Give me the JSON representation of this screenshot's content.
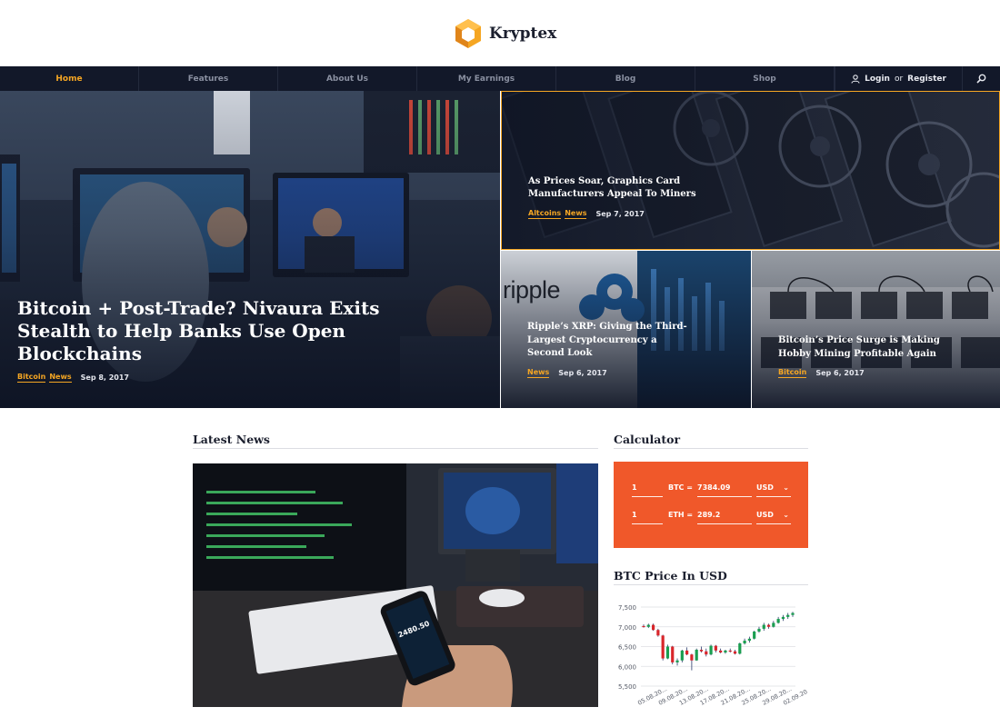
{
  "brand": {
    "name": "Kryptex",
    "accent": "#f5a623",
    "logo_icon": "hexagon-cube-icon"
  },
  "nav": {
    "items": [
      {
        "label": "Home",
        "active": true
      },
      {
        "label": "Features",
        "active": false
      },
      {
        "label": "About Us",
        "active": false
      },
      {
        "label": "My Earnings",
        "active": false
      },
      {
        "label": "Blog",
        "active": false
      },
      {
        "label": "Shop",
        "active": false
      }
    ],
    "login": {
      "label": "Login",
      "or": "or",
      "register": "Register",
      "icon": "user-icon"
    },
    "search_icon": "search-icon"
  },
  "hero": {
    "main": {
      "title_lines": [
        "Bitcoin + Post-Trade? Nivaura Exits",
        "Stealth to Help Banks Use Open",
        "Blockchains"
      ],
      "tags": [
        "Bitcoin",
        "News"
      ],
      "date": "Sep 8, 2017"
    },
    "top_right": {
      "title_lines": [
        "As Prices Soar, Graphics Card",
        "Manufacturers Appeal To Miners"
      ],
      "tags": [
        "Altcoins",
        "News"
      ],
      "date": "Sep 7, 2017"
    },
    "bottom_left": {
      "title_lines": [
        "Ripple’s XRP: Giving the Third-",
        "Largest Cryptocurrency a",
        "Second Look"
      ],
      "tags": [
        "News"
      ],
      "date": "Sep 6, 2017",
      "logo_text": "ripple"
    },
    "bottom_right": {
      "title_lines": [
        "Bitcoin’s Price Surge is Making",
        "Hobby Mining Profitable Again"
      ],
      "tags": [
        "Bitcoin"
      ],
      "date": "Sep 6, 2017"
    }
  },
  "latest_news": {
    "heading": "Latest News",
    "phone_price": "2480.50"
  },
  "calculator": {
    "heading": "Calculator",
    "color": "#f0582a",
    "rows": [
      {
        "amount": "1",
        "coin": "BTC =",
        "value": "7384.09",
        "currency": "USD"
      },
      {
        "amount": "1",
        "coin": "ETH =",
        "value": "289.2",
        "currency": "USD"
      }
    ]
  },
  "price_chart_heading": "BTC Price In USD",
  "chart_data": {
    "type": "candlestick",
    "title": "BTC Price In USD",
    "ylim": [
      5750,
      7600
    ],
    "y_ticks": [
      "7,500",
      "7,000",
      "6,500",
      "6,000",
      "5,500"
    ],
    "x_tick_labels": [
      "05.08.20...",
      "09.08.20...",
      "13.08.20...",
      "17.08.20...",
      "21.08.20...",
      "25.08.20...",
      "29.08.20...",
      "02.09.20..."
    ],
    "up_color": "#1a9e50",
    "down_color": "#d9262b",
    "grid": true,
    "candles": [
      {
        "o": 7020,
        "h": 7060,
        "l": 6980,
        "c": 7000
      },
      {
        "o": 7000,
        "h": 7080,
        "l": 6970,
        "c": 7050
      },
      {
        "o": 7050,
        "h": 7080,
        "l": 6900,
        "c": 6920
      },
      {
        "o": 6920,
        "h": 6950,
        "l": 6750,
        "c": 6780
      },
      {
        "o": 6780,
        "h": 6800,
        "l": 6150,
        "c": 6200
      },
      {
        "o": 6200,
        "h": 6550,
        "l": 6180,
        "c": 6500
      },
      {
        "o": 6500,
        "h": 6520,
        "l": 6050,
        "c": 6100
      },
      {
        "o": 6100,
        "h": 6200,
        "l": 6020,
        "c": 6150
      },
      {
        "o": 6150,
        "h": 6420,
        "l": 6100,
        "c": 6400
      },
      {
        "o": 6400,
        "h": 6480,
        "l": 6280,
        "c": 6300
      },
      {
        "o": 6300,
        "h": 6320,
        "l": 5900,
        "c": 6150
      },
      {
        "o": 6150,
        "h": 6450,
        "l": 6140,
        "c": 6420
      },
      {
        "o": 6420,
        "h": 6500,
        "l": 6350,
        "c": 6380
      },
      {
        "o": 6380,
        "h": 6450,
        "l": 6250,
        "c": 6300
      },
      {
        "o": 6300,
        "h": 6550,
        "l": 6280,
        "c": 6520
      },
      {
        "o": 6520,
        "h": 6540,
        "l": 6350,
        "c": 6400
      },
      {
        "o": 6400,
        "h": 6450,
        "l": 6330,
        "c": 6350
      },
      {
        "o": 6350,
        "h": 6420,
        "l": 6320,
        "c": 6400
      },
      {
        "o": 6400,
        "h": 6450,
        "l": 6350,
        "c": 6380
      },
      {
        "o": 6380,
        "h": 6420,
        "l": 6300,
        "c": 6320
      },
      {
        "o": 6320,
        "h": 6600,
        "l": 6300,
        "c": 6580
      },
      {
        "o": 6580,
        "h": 6700,
        "l": 6550,
        "c": 6650
      },
      {
        "o": 6650,
        "h": 6750,
        "l": 6600,
        "c": 6700
      },
      {
        "o": 6700,
        "h": 6900,
        "l": 6680,
        "c": 6880
      },
      {
        "o": 6880,
        "h": 7000,
        "l": 6850,
        "c": 6950
      },
      {
        "o": 6950,
        "h": 7100,
        "l": 6900,
        "c": 7050
      },
      {
        "o": 7050,
        "h": 7080,
        "l": 6950,
        "c": 7000
      },
      {
        "o": 7000,
        "h": 7150,
        "l": 6980,
        "c": 7100
      },
      {
        "o": 7100,
        "h": 7250,
        "l": 7080,
        "c": 7200
      },
      {
        "o": 7200,
        "h": 7300,
        "l": 7150,
        "c": 7250
      },
      {
        "o": 7250,
        "h": 7350,
        "l": 7200,
        "c": 7300
      },
      {
        "o": 7300,
        "h": 7380,
        "l": 7250,
        "c": 7350
      }
    ]
  }
}
